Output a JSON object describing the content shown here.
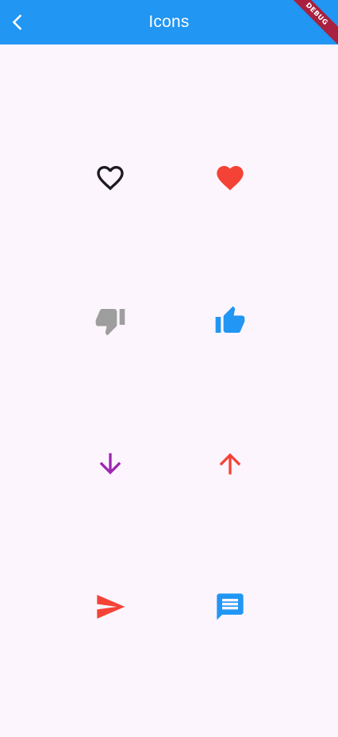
{
  "app_bar": {
    "title": "Icons",
    "back_icon": "chevron-left-icon",
    "background": "#2196f3"
  },
  "debug_banner": {
    "label": "DEBUG",
    "color": "#a8213f"
  },
  "icons": [
    {
      "name": "favorite-border-icon",
      "color": "#1c1b1f"
    },
    {
      "name": "favorite-icon",
      "color": "#f44336"
    },
    {
      "name": "thumb-down-icon",
      "color": "#9e9e9e"
    },
    {
      "name": "thumb-up-icon",
      "color": "#2196f3"
    },
    {
      "name": "arrow-downward-icon",
      "color": "#9c27b0"
    },
    {
      "name": "arrow-upward-icon",
      "color": "#f44336"
    },
    {
      "name": "send-icon",
      "color": "#f44336"
    },
    {
      "name": "message-icon",
      "color": "#2196f3"
    }
  ]
}
